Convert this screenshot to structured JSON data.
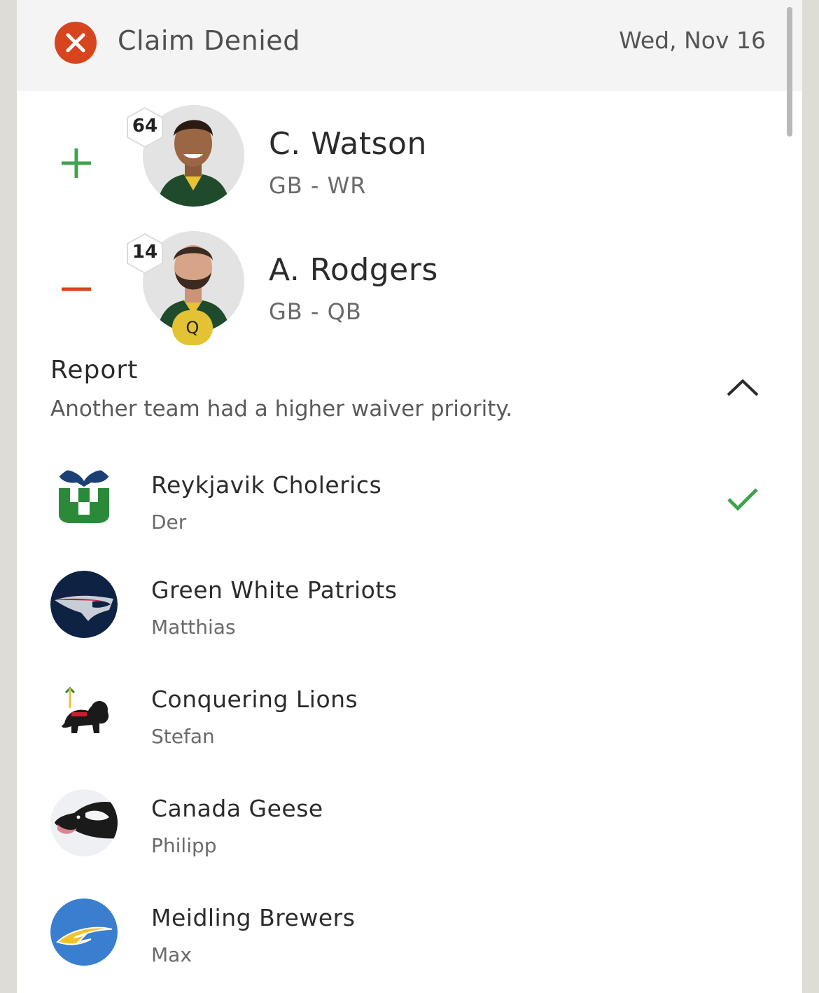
{
  "header": {
    "status": "Claim Denied",
    "status_icon": "close-circle-icon",
    "date": "Wed, Nov 16",
    "status_color": "#d7451f"
  },
  "players": [
    {
      "action": "add",
      "rank": "64",
      "name": "C. Watson",
      "position": "GB - WR",
      "action_color": "#3fa34d"
    },
    {
      "action": "drop",
      "rank": "14",
      "name": "A. Rodgers",
      "position": "GB - QB",
      "status_badge": "Q",
      "action_color": "#d7451f"
    }
  ],
  "report": {
    "title": "Report",
    "message": "Another team had a higher waiver priority.",
    "toggle_icon": "chevron-up-icon"
  },
  "teams": [
    {
      "name": "Reykjavik Cholerics",
      "owner": "Der",
      "logo": "whalers-logo",
      "winner": true
    },
    {
      "name": "Green White Patriots",
      "owner": "Matthias",
      "logo": "patriots-logo"
    },
    {
      "name": "Conquering Lions",
      "owner": "Stefan",
      "logo": "lion-logo"
    },
    {
      "name": "Canada Geese",
      "owner": "Philipp",
      "logo": "goose-logo"
    },
    {
      "name": "Meidling Brewers",
      "owner": "Max",
      "logo": "chargers-logo"
    }
  ]
}
